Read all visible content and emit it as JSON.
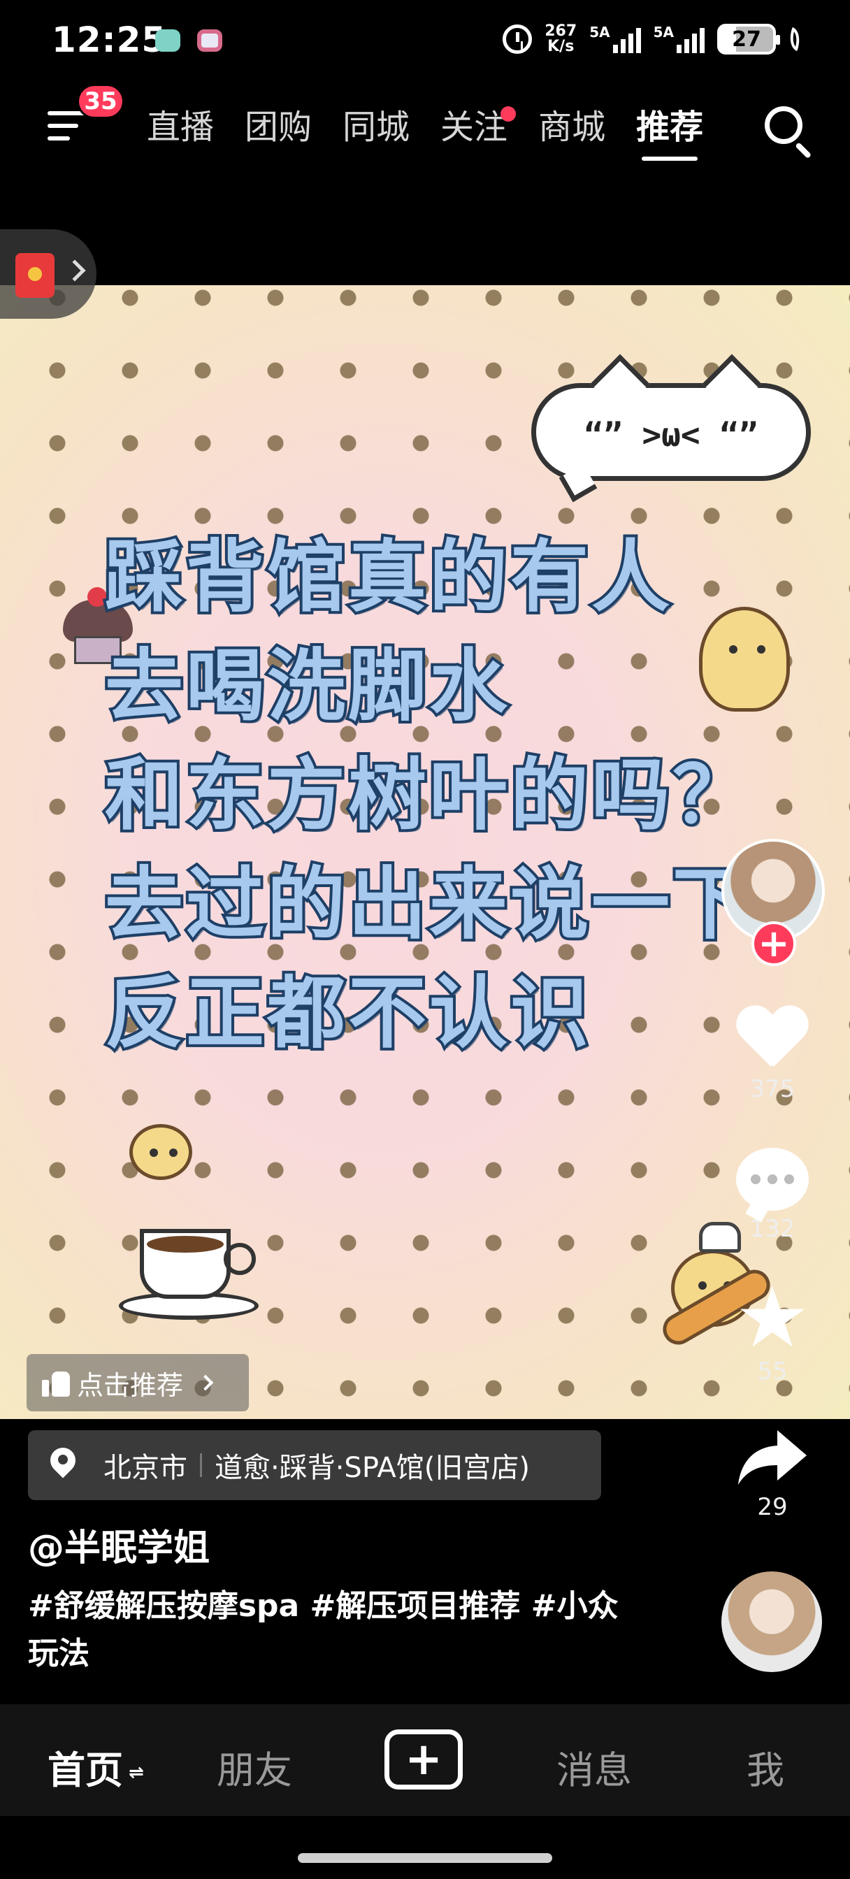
{
  "status_bar": {
    "time": "12:25",
    "net_speed_value": "267",
    "net_speed_unit": "K/s",
    "sim1_label": "5A",
    "sim2_label": "5A",
    "battery": "27"
  },
  "top_nav": {
    "menu_badge": "35",
    "tabs": [
      {
        "label": "直播"
      },
      {
        "label": "团购"
      },
      {
        "label": "同城"
      },
      {
        "label": "关注"
      },
      {
        "label": "商城"
      },
      {
        "label": "推荐"
      }
    ],
    "active_tab": "推荐"
  },
  "video": {
    "bubble_face": "“” >ω< “”",
    "caption_lines": [
      "踩背馆真的有人",
      "去喝洗脚水",
      "和东方树叶的吗？",
      "去过的出来说一下",
      "反正都不认识"
    ],
    "recommend_label": "点击推荐"
  },
  "sidebar": {
    "likes": "375",
    "comments": "132",
    "favorites": "55",
    "shares": "29"
  },
  "info": {
    "city": "北京市",
    "poi": "道愈·踩背·SPA馆(旧宫店)",
    "username": "@半眠学姐",
    "description": "#舒缓解压按摩spa #解压项目推荐 #小众玩法"
  },
  "bottom_nav": {
    "home": "首页",
    "home_switch": "⇌",
    "friends": "朋友",
    "add": "+",
    "messages": "消息",
    "me": "我"
  },
  "colors": {
    "accent_red": "#ff3b5c",
    "caption_fill": "#a7c9ee",
    "caption_stroke": "#1e3f66"
  }
}
